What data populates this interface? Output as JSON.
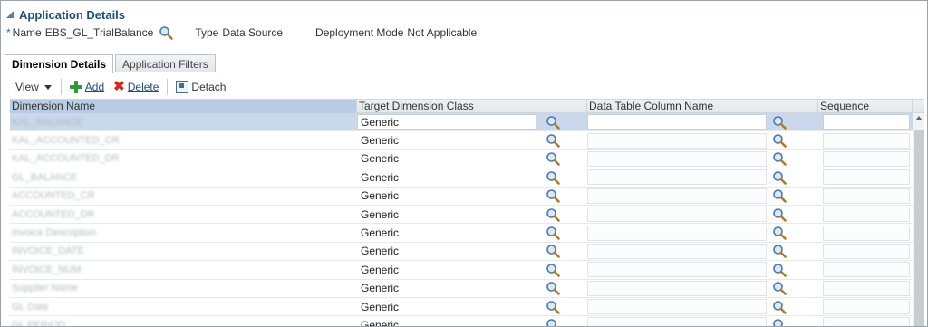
{
  "section": {
    "title": "Application Details"
  },
  "props": {
    "required_mark": "*",
    "name_label": "Name",
    "name_value": "EBS_GL_TrialBalance",
    "type_label": "Type",
    "type_value": "Data Source",
    "mode_label": "Deployment Mode",
    "mode_value": "Not Applicable"
  },
  "tabs": [
    {
      "label": "Dimension Details",
      "active": true
    },
    {
      "label": "Application Filters",
      "active": false
    }
  ],
  "toolbar": {
    "view_label": "View",
    "add_label": "Add",
    "delete_label": "Delete",
    "detach_label": "Detach"
  },
  "table": {
    "headers": [
      "Dimension Name",
      "Target Dimension Class",
      "Data Table Column Name",
      "Sequence"
    ],
    "rows": [
      {
        "name": "KAL_BALANCE",
        "cls": "Generic",
        "selected": true
      },
      {
        "name": "KAL_ACCOUNTED_CR",
        "cls": "Generic"
      },
      {
        "name": "KAL_ACCOUNTED_DR",
        "cls": "Generic"
      },
      {
        "name": "GL_BALANCE",
        "cls": "Generic"
      },
      {
        "name": "ACCOUNTED_CR",
        "cls": "Generic"
      },
      {
        "name": "ACCOUNTED_DR",
        "cls": "Generic"
      },
      {
        "name": "Invoice Description",
        "cls": "Generic"
      },
      {
        "name": "INVOICE_DATE",
        "cls": "Generic"
      },
      {
        "name": "INVOICE_NUM",
        "cls": "Generic"
      },
      {
        "name": "Supplier Name",
        "cls": "Generic"
      },
      {
        "name": "GL Date",
        "cls": "Generic"
      },
      {
        "name": "GL PERIOD",
        "cls": "Generic"
      }
    ]
  }
}
